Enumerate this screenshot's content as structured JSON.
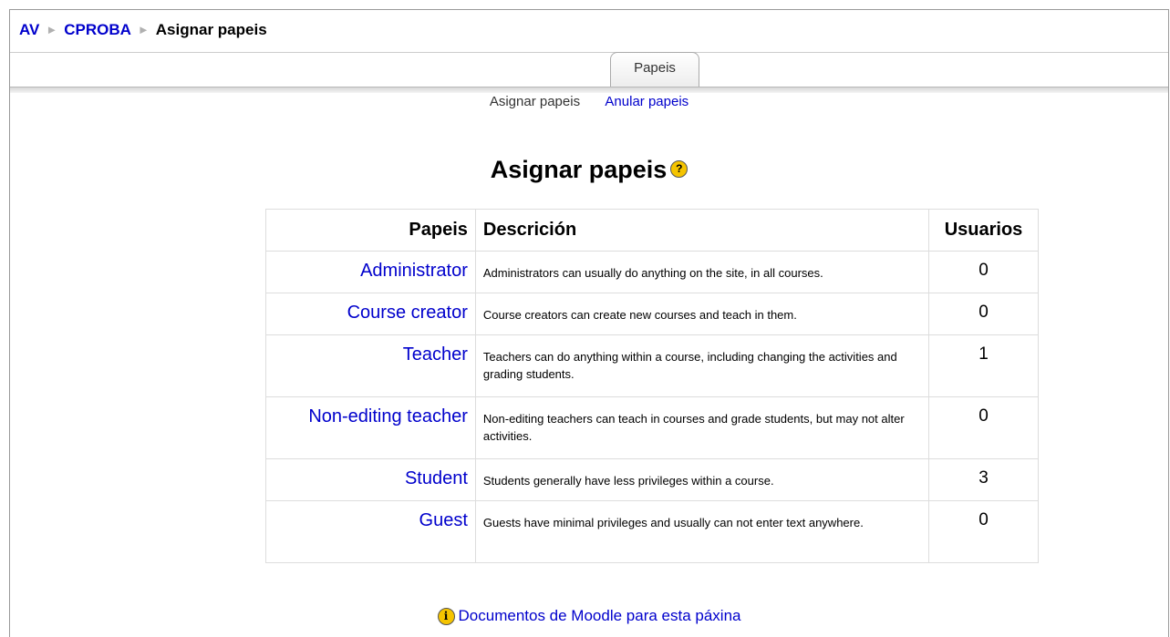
{
  "breadcrumb": {
    "root": "AV",
    "course": "CPROBA",
    "current": "Asignar papeis",
    "separator": "►"
  },
  "tabs": {
    "active": "Papeis",
    "subtabs": {
      "current": "Asignar papeis",
      "link": "Anular papeis"
    }
  },
  "heading": {
    "title": "Asignar papeis",
    "help_icon": "help-icon",
    "help_glyph": "?"
  },
  "table": {
    "headers": {
      "role": "Papeis",
      "description": "Descrición",
      "users": "Usuarios"
    },
    "rows": [
      {
        "role": "Administrator",
        "description": "Administrators can usually do anything on the site, in all courses.",
        "users": "0"
      },
      {
        "role": "Course creator",
        "description": "Course creators can create new courses and teach in them.",
        "users": "0"
      },
      {
        "role": "Teacher",
        "description": "Teachers can do anything within a course, including changing the activities and grading students.",
        "users": "1"
      },
      {
        "role": "Non-editing teacher",
        "description": "Non-editing teachers can teach in courses and grade students, but may not alter activities.",
        "users": "0"
      },
      {
        "role": "Student",
        "description": "Students generally have less privileges within a course.",
        "users": "3"
      },
      {
        "role": "Guest",
        "description": "Guests have minimal privileges and usually can not enter text anywhere.",
        "users": "0"
      }
    ]
  },
  "footer": {
    "docs_link": "Documentos de Moodle para esta páxina",
    "docs_icon": "info-icon",
    "docs_glyph": "i"
  },
  "colors": {
    "link": "#0000cc",
    "border": "#dddddd",
    "icon": "#f5c400"
  }
}
